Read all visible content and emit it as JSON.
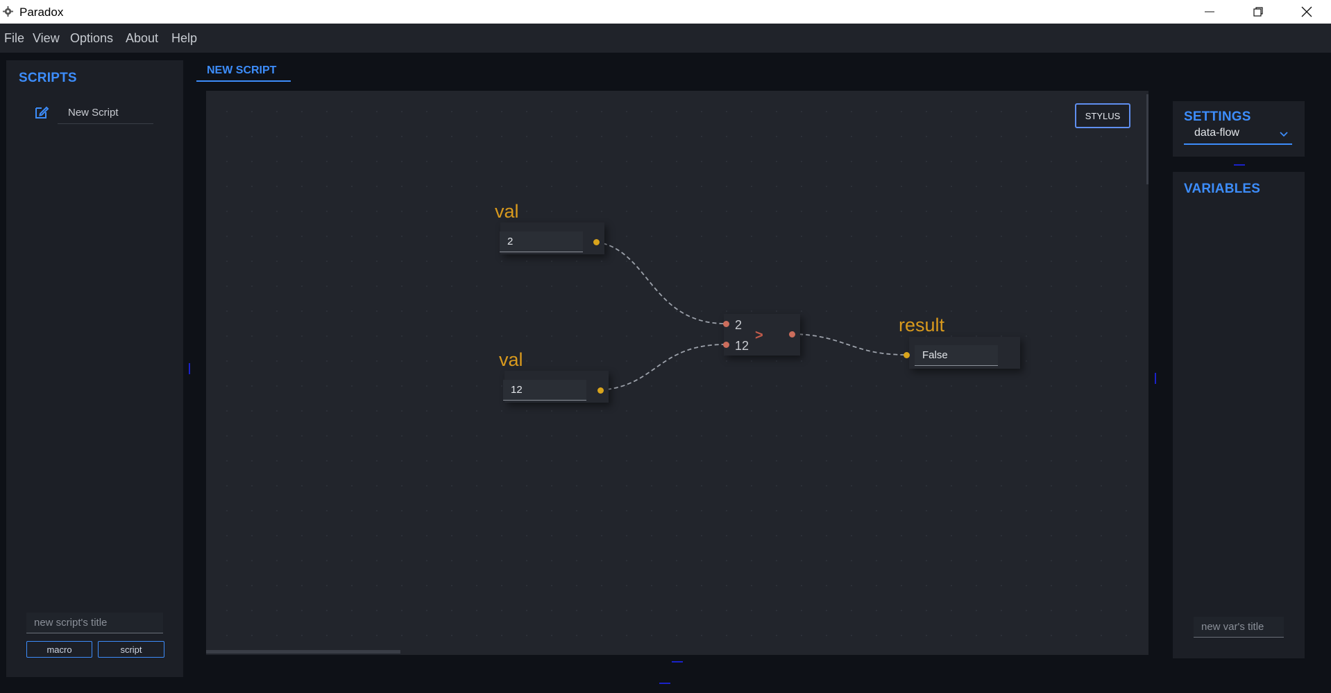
{
  "window": {
    "title": "Paradox"
  },
  "menu": [
    "File",
    "View",
    "Options",
    "About",
    "Help"
  ],
  "scripts_panel": {
    "heading": "SCRIPTS",
    "items": [
      {
        "label": "New Script",
        "icon": "edit-icon"
      }
    ],
    "title_input_placeholder": "new script's title",
    "macro_button": "macro",
    "script_button": "script"
  },
  "editor": {
    "tab_label": "NEW SCRIPT",
    "stylus_button": "STYLUS",
    "nodes": {
      "val_a": {
        "title": "val",
        "value": "2"
      },
      "val_b": {
        "title": "val",
        "value": "12"
      },
      "compare": {
        "input_a": "2",
        "input_b": "12",
        "symbol": ">"
      },
      "result": {
        "title": "result",
        "value": "False"
      }
    }
  },
  "settings_panel": {
    "heading": "SETTINGS",
    "mode": "data-flow"
  },
  "variables_panel": {
    "heading": "VARIABLES",
    "new_var_placeholder": "new var's title"
  },
  "colors": {
    "accent": "#3d8dfb",
    "node_title": "#d99a1d",
    "port_data": "#d9a41c",
    "port_op": "#cc6d5c"
  }
}
